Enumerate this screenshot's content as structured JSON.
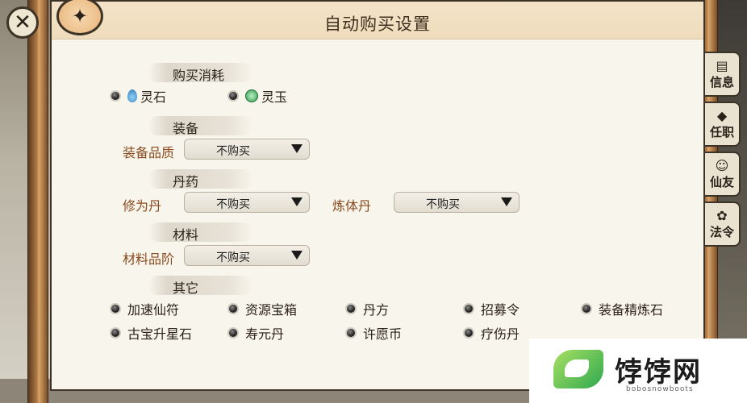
{
  "window": {
    "title": "自动购买设置"
  },
  "side_tabs": [
    {
      "label": "信息",
      "icon": "scroll-icon"
    },
    {
      "label": "任职",
      "icon": "badge-icon"
    },
    {
      "label": "仙友",
      "icon": "friend-icon"
    },
    {
      "label": "法令",
      "icon": "decree-icon"
    }
  ],
  "sections": {
    "currency": {
      "title": "购买消耗",
      "options": [
        {
          "label": "灵石",
          "icon": "spirit-stone-icon",
          "selected": true
        },
        {
          "label": "灵玉",
          "icon": "spirit-jade-icon",
          "selected": true
        }
      ]
    },
    "equipment": {
      "title": "装备",
      "field_label": "装备品质",
      "field_value": "不购买"
    },
    "pills": {
      "title": "丹药",
      "field1_label": "修为丹",
      "field1_value": "不购买",
      "field2_label": "炼体丹",
      "field2_value": "不购买"
    },
    "materials": {
      "title": "材料",
      "field_label": "材料品阶",
      "field_value": "不购买"
    },
    "other": {
      "title": "其它",
      "items": [
        {
          "label": "加速仙符",
          "selected": true
        },
        {
          "label": "资源宝箱",
          "selected": true
        },
        {
          "label": "丹方",
          "selected": true
        },
        {
          "label": "招募令",
          "selected": true
        },
        {
          "label": "装备精炼石",
          "selected": true
        },
        {
          "label": "古宝升星石",
          "selected": true
        },
        {
          "label": "寿元丹",
          "selected": true
        },
        {
          "label": "许愿币",
          "selected": true
        },
        {
          "label": "疗伤丹",
          "selected": true
        }
      ]
    }
  },
  "watermark": {
    "name": "饽饽网",
    "url": "bobosnowboots"
  },
  "colors": {
    "label_brown": "#8a4b1f",
    "panel_bg": "#f8f5ec",
    "header_bg": "#f3e3c8"
  }
}
